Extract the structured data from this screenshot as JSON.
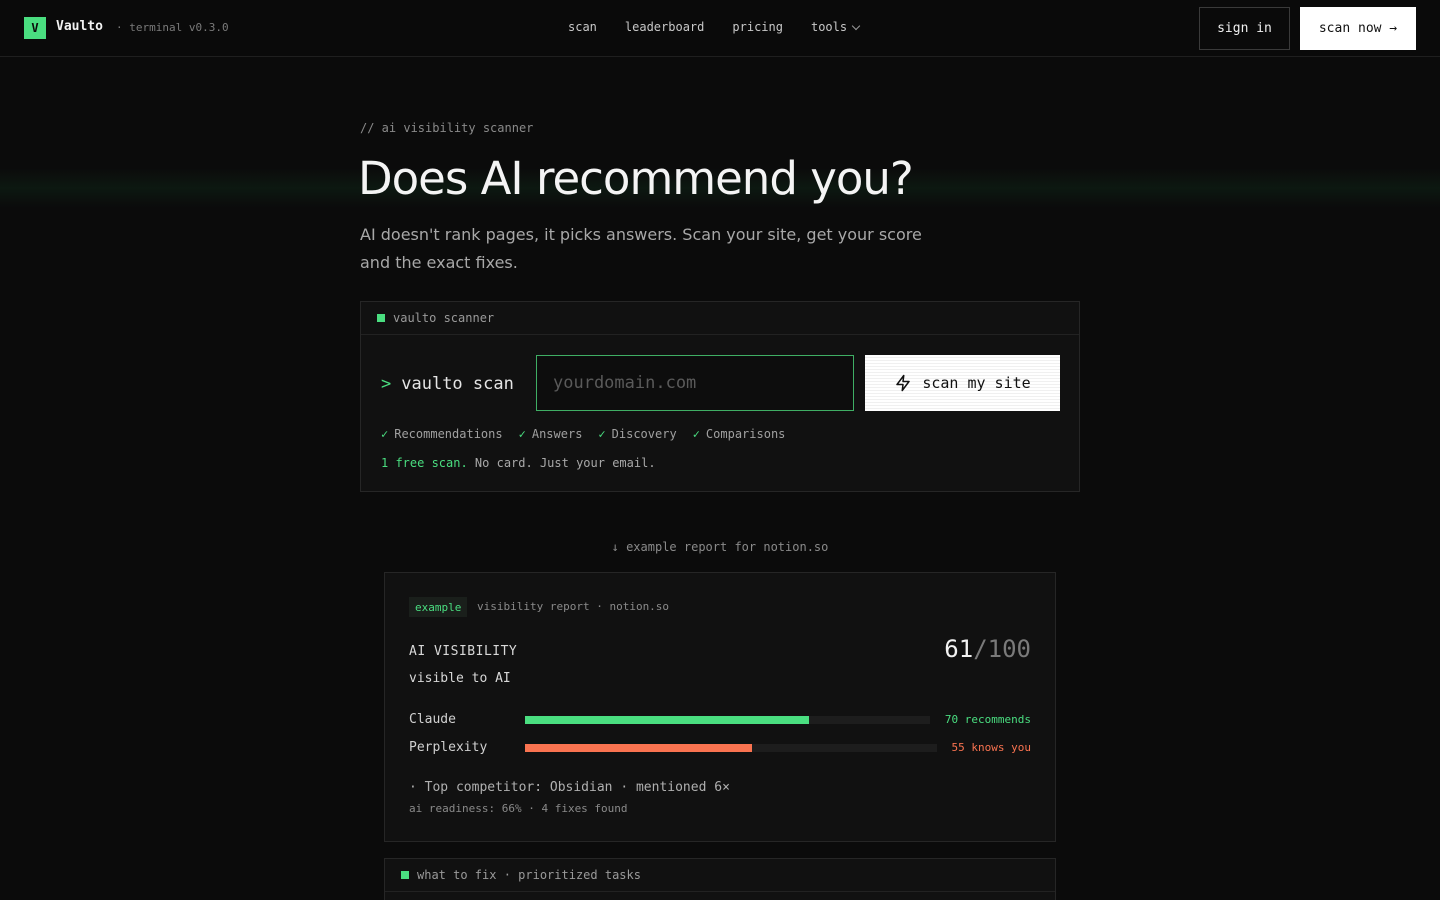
{
  "nav": {
    "logo_letter": "V",
    "brand": "Vaulto",
    "version": "· terminal v0.3.0",
    "links": [
      "scan",
      "leaderboard",
      "pricing",
      "tools"
    ],
    "sign_in": "sign in",
    "scan_now": "scan now →"
  },
  "hero": {
    "eyebrow": "// ai visibility scanner",
    "title": "Does AI recommend you?",
    "subtitle": "AI doesn't rank pages, it picks answers. Scan your site, get your score and the exact fixes."
  },
  "scanner": {
    "header": "vaulto scanner",
    "prompt_symbol": ">",
    "prompt_text": "vaulto scan",
    "input_placeholder": "yourdomain.com",
    "input_value": "",
    "button_label": "scan my site",
    "checks": [
      "Recommendations",
      "Answers",
      "Discovery",
      "Comparisons"
    ],
    "free_highlight": "1 free scan.",
    "free_rest": " No card. Just your email."
  },
  "example_label": "↓ example report for notion.so",
  "report": {
    "tag": "example",
    "meta": "visibility report · notion.so",
    "heading": "AI VISIBILITY",
    "status": "visible to AI",
    "score": "61",
    "score_den": "/100",
    "bars": [
      {
        "label": "Claude",
        "value": 70,
        "value_text": "70 recommends",
        "color": "#4ade80"
      },
      {
        "label": "Perplexity",
        "value": 55,
        "value_text": "55 knows you",
        "color": "#f97350"
      }
    ],
    "competitor": "· Top competitor: Obsidian · mentioned 6×",
    "footer": "ai readiness: 66% · 4 fixes found"
  },
  "fix_panel": {
    "header": "what to fix · prioritized tasks"
  },
  "colors": {
    "accent": "#4ade80",
    "warning": "#f97350",
    "background": "#0b0b0b"
  }
}
